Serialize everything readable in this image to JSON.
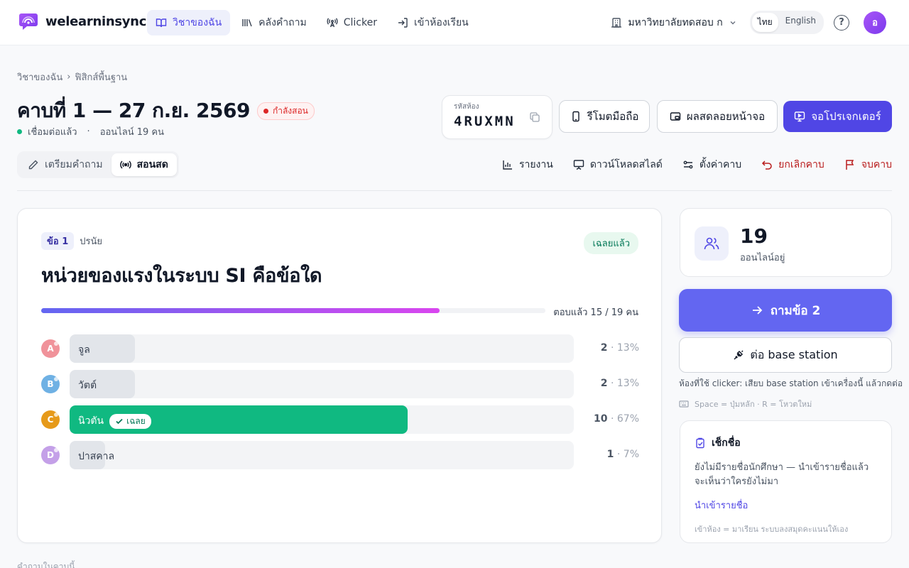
{
  "brand": {
    "name": "welearninsync",
    "icon": "chat-logo-icon"
  },
  "nav": [
    {
      "label": "วิชาของฉัน",
      "icon": "book-icon",
      "active": true
    },
    {
      "label": "คลังคำถาม",
      "icon": "library-icon"
    },
    {
      "label": "Clicker",
      "icon": "antenna-icon"
    },
    {
      "label": "เข้าห้องเรียน",
      "icon": "login-icon"
    }
  ],
  "university": "มหาวิทยาลัยทดสอบ ก",
  "lang": {
    "th": "ไทย",
    "en": "English",
    "selected": "th"
  },
  "help_label": "?",
  "avatar_initial": "อ",
  "breadcrumb": {
    "root": "วิชาของฉัน",
    "sep": "›",
    "current": "ฟิสิกส์พื้นฐาน"
  },
  "session": {
    "title": "คาบที่ 1 — 27 ก.ย. 2569",
    "badge": "กำลังสอน",
    "connected": "เชื่อมต่อแล้ว",
    "sep": "·",
    "online": "ออนไลน์ 19 คน"
  },
  "room": {
    "label": "รหัสห้อง",
    "code": "4RUXMN"
  },
  "buttons": {
    "remote": "รีโมตมือถือ",
    "float": "ผลสดลอยหน้าจอ",
    "projector": "จอโปรเจกเตอร์"
  },
  "mode_tabs": [
    {
      "label": "เตรียมคำถาม",
      "icon": "pencil-icon"
    },
    {
      "label": "สอนสด",
      "icon": "broadcast-icon",
      "active": true
    }
  ],
  "actions": [
    {
      "label": "รายงาน",
      "icon": "bar-chart-icon"
    },
    {
      "label": "ดาวน์โหลดสไลด์",
      "icon": "presentation-icon"
    },
    {
      "label": "ตั้งค่าคาบ",
      "icon": "sliders-icon"
    },
    {
      "label": "ยกเลิกคาบ",
      "icon": "undo-icon",
      "danger": true
    },
    {
      "label": "จบคาบ",
      "icon": "flag-icon",
      "danger": true
    }
  ],
  "question": {
    "number": "ข้อ 1",
    "type": "ปรนัย",
    "status": "เฉลยแล้ว",
    "text": "หน่วยของแรงในระบบ SI คือข้อใด",
    "answered_text": "ตอบแล้ว 15 / 19 คน",
    "answered": 15,
    "total": 19,
    "correct_chip": "เฉลย",
    "options": [
      {
        "letter": "A",
        "label": "จูล",
        "count": "2",
        "pct": "13%",
        "value": 13,
        "color": "#f0929a"
      },
      {
        "letter": "B",
        "label": "วัตต์",
        "count": "2",
        "pct": "13%",
        "value": 13,
        "color": "#6fb1e4"
      },
      {
        "letter": "C",
        "label": "นิวตัน",
        "count": "10",
        "pct": "67%",
        "value": 67,
        "color": "#e69a1a",
        "correct": true
      },
      {
        "letter": "D",
        "label": "ปาสคาล",
        "count": "1",
        "pct": "7%",
        "value": 7,
        "color": "#c4a0e8"
      }
    ]
  },
  "side": {
    "online_count": "19",
    "online_label": "ออนไลน์อยู่",
    "next": "ถามข้อ 2",
    "base": "ต่อ base station",
    "hint": "ห้องที่ใช้ clicker: เสียบ base station เข้าเครื่องนี้ แล้วกดต่อ",
    "keys": "Space = ปุ่มหลัก · R = โหวตใหม่",
    "roll_title": "เช็กชื่อ",
    "roll_desc": "ยังไม่มีรายชื่อนักศึกษา — นำเข้ารายชื่อแล้วจะเห็นว่าใครยังไม่มา",
    "roll_link": "นำเข้ารายชื่อ",
    "roll_note": "เข้าห้อง = มาเรียน ระบบลงสมุดคะแนนให้เอง"
  },
  "bottom_label": "คำถามในคาบนี้",
  "colors": {
    "accent": "#5046e5",
    "success": "#10b981",
    "danger": "#dc2626"
  }
}
